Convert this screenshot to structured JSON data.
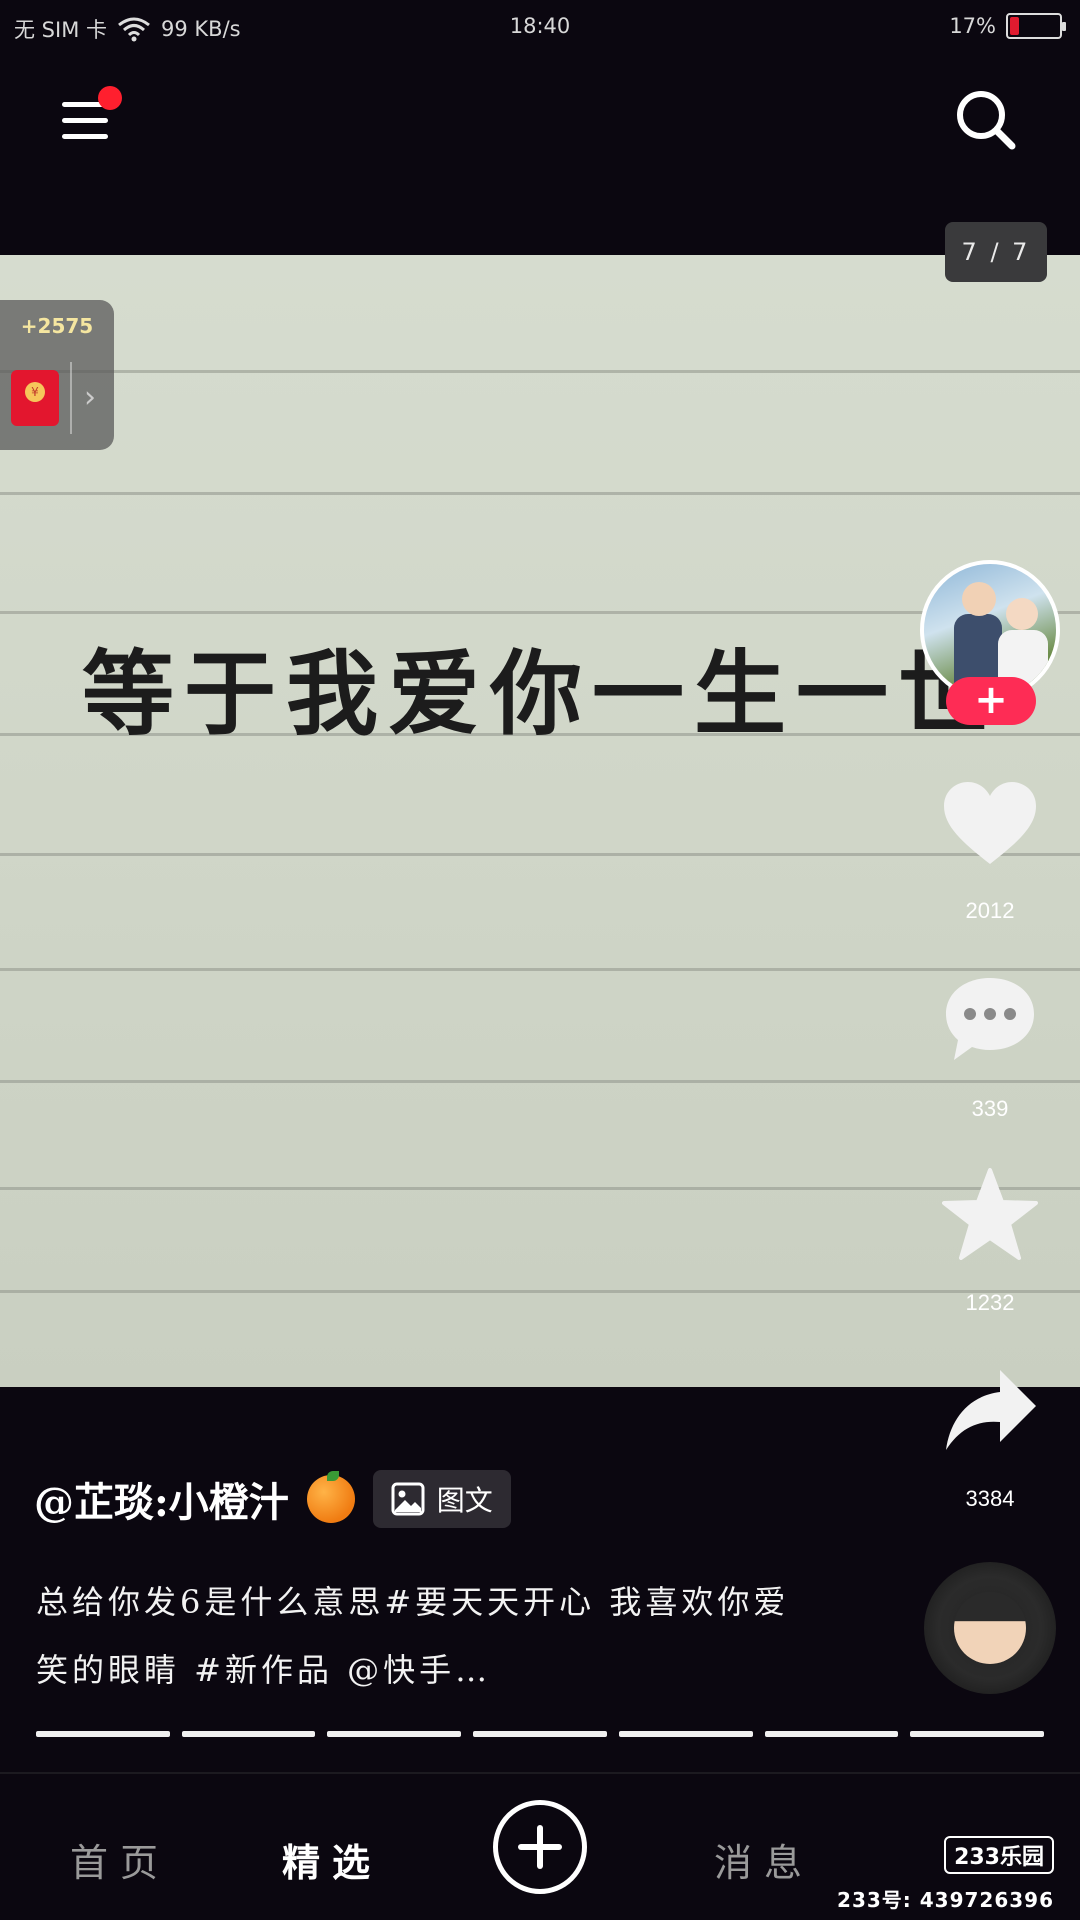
{
  "status_bar": {
    "carrier": "无 SIM 卡",
    "net_speed": "99 KB/s",
    "time": "18:40",
    "battery_percent": "17%",
    "battery_level": 0.17,
    "battery_color": "#e01b2f"
  },
  "header": {
    "menu_icon": "menu-icon",
    "search_icon": "search-icon",
    "page_counter": "7 / 7"
  },
  "reward": {
    "amount": "+2575",
    "icon": "red-packet-icon",
    "seal": "¥"
  },
  "post": {
    "image_text": "等于我爱你一生一世"
  },
  "actions": {
    "follow": "+",
    "likes": "2012",
    "comments": "339",
    "favorites": "1232",
    "shares": "3384"
  },
  "caption": {
    "author": "@芷琰:小橙汁",
    "tag_label": "图文",
    "text": "总给你发6是什么意思#要天天开心 我喜欢你爱笑的眼睛 #新作品 @快手…",
    "progress_segments": 7
  },
  "bottom_nav": {
    "home": "首页",
    "featured": "精选",
    "messages": "消息"
  },
  "watermark": {
    "logo": "233乐园",
    "id": "233号: 439726396"
  },
  "colors": {
    "accent": "#fe2c55",
    "background": "#0b0710"
  }
}
